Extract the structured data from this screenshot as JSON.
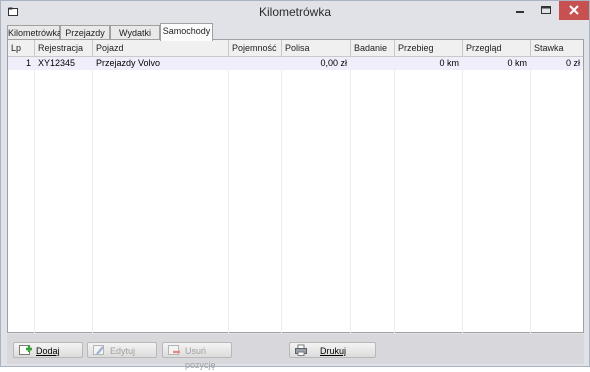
{
  "window": {
    "title": "Kilometrówka"
  },
  "tabs": [
    {
      "label": "Kilometrówka"
    },
    {
      "label": "Przejazdy"
    },
    {
      "label": "Wydatki"
    },
    {
      "label": "Samochody"
    }
  ],
  "active_tab": "Samochody",
  "grid": {
    "columns": [
      "Lp",
      "Rejestracja",
      "Pojazd",
      "Pojemność",
      "Polisa",
      "Badanie",
      "Przebieg",
      "Przegląd",
      "Stawka"
    ],
    "rows": [
      {
        "lp": "1",
        "rejestracja": "XY12345",
        "pojazd": "Przejazdy Volvo",
        "pojemnosc": "",
        "polisa": "0,00 zł",
        "badanie": "",
        "przebieg": "0 km",
        "przeglad": "0 km",
        "stawka": "0 zł"
      }
    ]
  },
  "footer": {
    "add_label": "Dodaj",
    "edit_label": "Edytuj",
    "delete_label": "Usuń pozycję",
    "print_label": "Drukuj"
  },
  "colors": {
    "selected_row": "#f0eefa",
    "close_button": "#c75050",
    "add_icon": "#3aa13a",
    "delete_icon": "#d24a4a"
  }
}
